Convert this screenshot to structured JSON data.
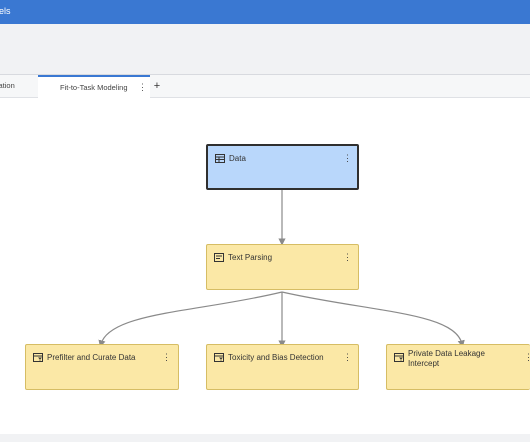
{
  "app": {
    "title": "els"
  },
  "tabs": [
    {
      "label": "ration",
      "active": false
    },
    {
      "label": "Fit-to-Task Modeling",
      "active": true,
      "menu": "⋮"
    }
  ],
  "tab_add": "+",
  "nodes": {
    "data": {
      "label": "Data",
      "icon": "table-icon",
      "menu": "⋮"
    },
    "text_parsing": {
      "label": "Text Parsing",
      "icon": "text-icon",
      "menu": "⋮"
    },
    "prefilter": {
      "label": "Prefilter and Curate Data",
      "icon": "filter-table-icon",
      "menu": "⋮"
    },
    "toxicity": {
      "label": "Toxicity and Bias Detection",
      "icon": "filter-table-icon",
      "menu": "⋮"
    },
    "private_data": {
      "label_line1": "Private Data Leakage",
      "label_line2": "Intercept",
      "icon": "filter-table-icon",
      "menu": "⋮"
    }
  },
  "colors": {
    "header": "#3a78d2",
    "data_node": "#b9d7fb",
    "process_node": "#fbe8a6",
    "link": "#8a8a8a"
  }
}
